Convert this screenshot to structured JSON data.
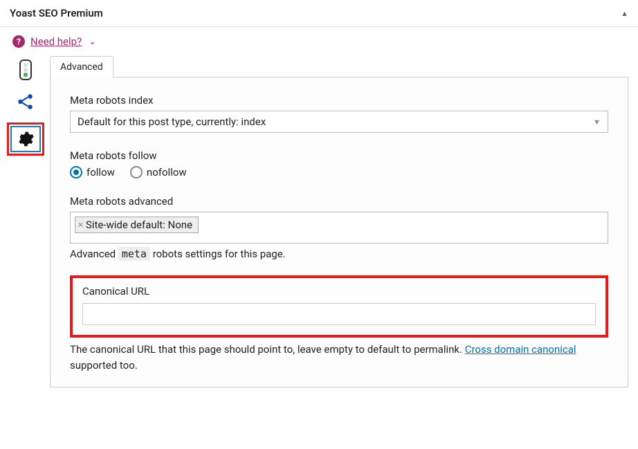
{
  "header": {
    "title": "Yoast SEO Premium"
  },
  "help": {
    "link": "Need help?"
  },
  "tabs": {
    "advanced": "Advanced"
  },
  "meta_index": {
    "label": "Meta robots index",
    "selected": "Default for this post type, currently: index"
  },
  "meta_follow": {
    "label": "Meta robots follow",
    "options": {
      "follow": "follow",
      "nofollow": "nofollow"
    },
    "selected": "follow"
  },
  "meta_advanced": {
    "label": "Meta robots advanced",
    "tag": "Site-wide default: None",
    "hint_pre": "Advanced ",
    "hint_code": "meta",
    "hint_post": " robots settings for this page."
  },
  "canonical": {
    "label": "Canonical URL",
    "value": "",
    "desc_pre": "The canonical URL that this page should point to, leave empty to default to permalink. ",
    "link1": "Cross domain canonical",
    "desc_post": " supported too."
  }
}
